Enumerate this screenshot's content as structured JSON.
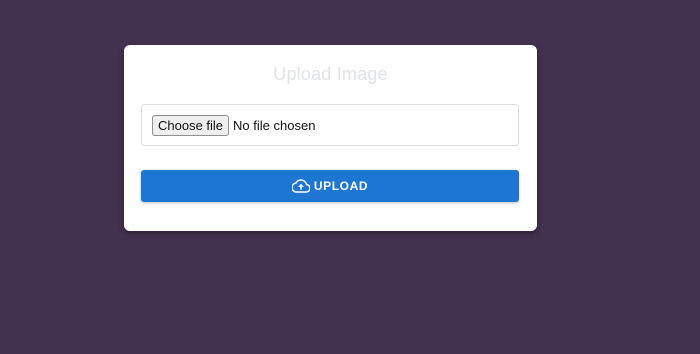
{
  "colors": {
    "background": "#42314f",
    "card": "#ffffff",
    "accent": "#1c76d2",
    "title": "#e1e3e8"
  },
  "card": {
    "title": "Upload Image"
  },
  "file_input": {
    "button_label": "Choose file",
    "status": "No file chosen"
  },
  "upload_button": {
    "label": "UPLOAD",
    "icon": "cloud-upload-icon"
  }
}
